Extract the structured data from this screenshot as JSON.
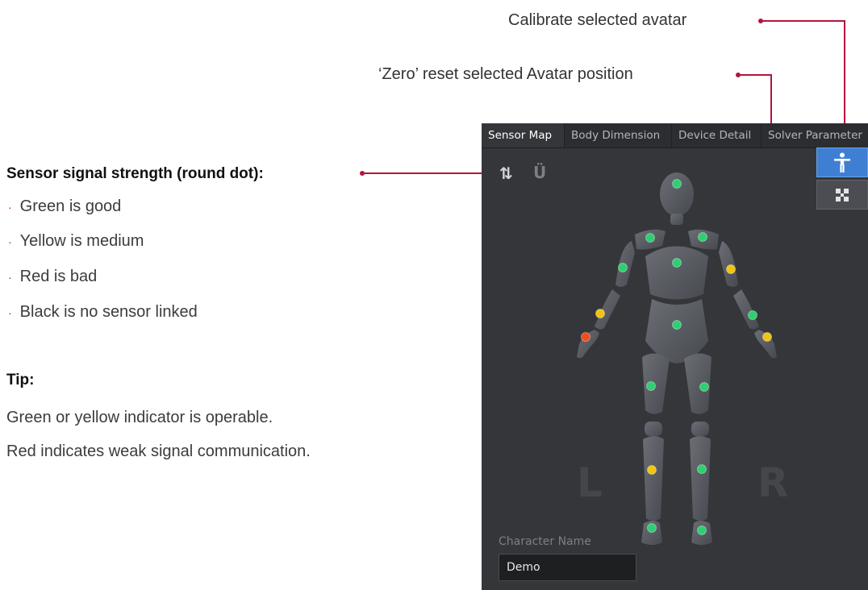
{
  "callouts": {
    "calibrate": "Calibrate selected avatar",
    "zero_reset": "‘Zero’ reset selected Avatar position",
    "signal_heading": "Sensor signal strength (round dot):"
  },
  "legend_items": [
    "Green is good",
    "Yellow is medium",
    "Red is bad",
    "Black is no sensor linked"
  ],
  "bullet_glyph": "·",
  "tip": {
    "heading": "Tip:",
    "lines": [
      "Green or yellow indicator is operable.",
      "Red indicates weak signal communication."
    ]
  },
  "app": {
    "tabs": [
      "Sensor Map",
      "Body Dimension",
      "Device Detail",
      "Solver Parameter"
    ],
    "active_tab": "Sensor Map",
    "toolbar_icons": [
      "swap-icon",
      "magnet-icon"
    ],
    "side_buttons": [
      "calibrate-avatar-icon",
      "zero-reset-icon"
    ],
    "left_label": "L",
    "right_label": "R",
    "character_name_label": "Character Name",
    "character_name_value": "Demo"
  },
  "sensors": [
    {
      "id": "head",
      "status": "good"
    },
    {
      "id": "left-shoulder",
      "status": "good"
    },
    {
      "id": "right-shoulder",
      "status": "good"
    },
    {
      "id": "chest",
      "status": "good"
    },
    {
      "id": "left-upper-arm",
      "status": "good"
    },
    {
      "id": "right-upper-arm",
      "status": "medium"
    },
    {
      "id": "left-forearm",
      "status": "medium"
    },
    {
      "id": "right-forearm",
      "status": "good"
    },
    {
      "id": "hips",
      "status": "good"
    },
    {
      "id": "left-hand",
      "status": "bad"
    },
    {
      "id": "right-hand",
      "status": "medium"
    },
    {
      "id": "left-thigh",
      "status": "good"
    },
    {
      "id": "right-thigh",
      "status": "good"
    },
    {
      "id": "left-shin",
      "status": "medium"
    },
    {
      "id": "right-shin",
      "status": "good"
    },
    {
      "id": "left-foot",
      "status": "good"
    },
    {
      "id": "right-foot",
      "status": "good"
    }
  ],
  "status_colors": {
    "good": "#2ecf71",
    "medium": "#f2c40f",
    "bad": "#f24a1c",
    "none": "#111111"
  },
  "accent_color": "#b4143c"
}
